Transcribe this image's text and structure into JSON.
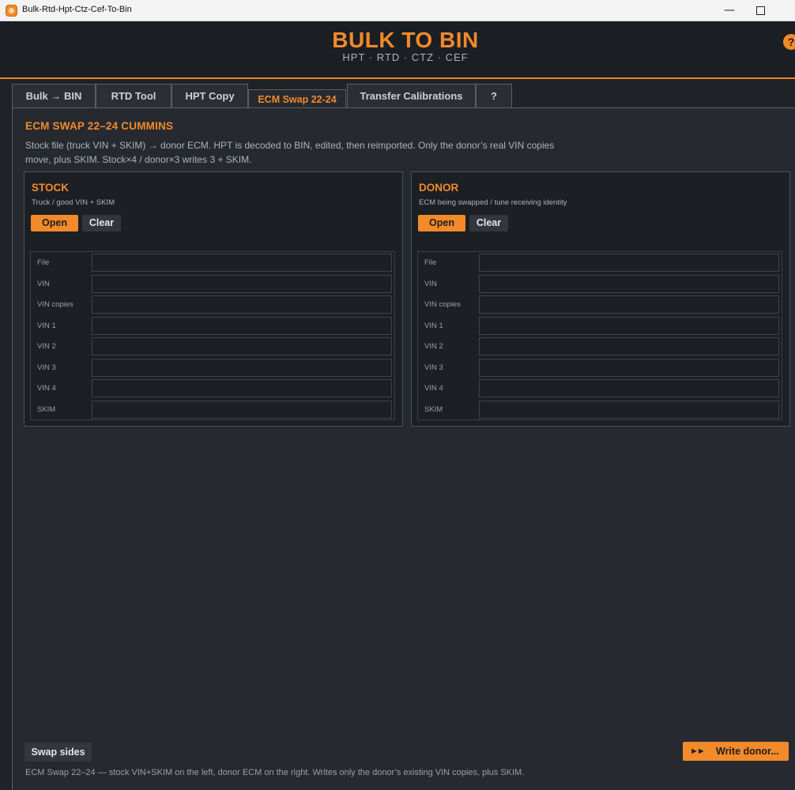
{
  "window": {
    "title": "Bulk-Rtd-Hpt-Ctz-Cef-To-Bin",
    "minimize": "—",
    "maximize": ""
  },
  "header": {
    "title": "BULK TO BIN",
    "subtitle": "HPT  ·  RTD  ·  CTZ  ·  CEF",
    "help": "?"
  },
  "tabs": [
    {
      "label": "Bulk → BIN",
      "active": false
    },
    {
      "label": "RTD Tool",
      "active": false
    },
    {
      "label": "HPT Copy",
      "active": false
    },
    {
      "label": "ECM Swap 22-24",
      "active": true
    },
    {
      "label": "Transfer Calibrations",
      "active": false
    },
    {
      "label": "?",
      "active": false
    }
  ],
  "main": {
    "title": "ECM SWAP  22–24 CUMMINS",
    "description": "Stock file (truck VIN + SKIM) → donor ECM. HPT is decoded to BIN, edited, then reimported. Only the donor’s real VIN copies move, plus SKIM. Stock×4 / donor×3 writes 3 + SKIM.",
    "stock": {
      "title": "STOCK",
      "subtitle": "Truck / good VIN + SKIM",
      "open_label": "Open",
      "clear_label": "Clear"
    },
    "donor": {
      "title": "DONOR",
      "subtitle": "ECM being swapped / tune receiving identity",
      "open_label": "Open",
      "clear_label": "Clear"
    },
    "field_labels": [
      "File",
      "VIN",
      "VIN copies",
      "VIN 1",
      "VIN 2",
      "VIN 3",
      "VIN 4",
      "SKIM"
    ],
    "swap_label": "Swap sides",
    "write_arrow": "►►",
    "write_label": "Write donor...",
    "footer": "ECM Swap 22–24 — stock VIN+SKIM on the left, donor ECM on the right. Writes only the donor’s existing VIN copies, plus SKIM."
  },
  "colors": {
    "accent": "#f28a2a",
    "background": "#1f2227",
    "panel": "#262a30"
  }
}
